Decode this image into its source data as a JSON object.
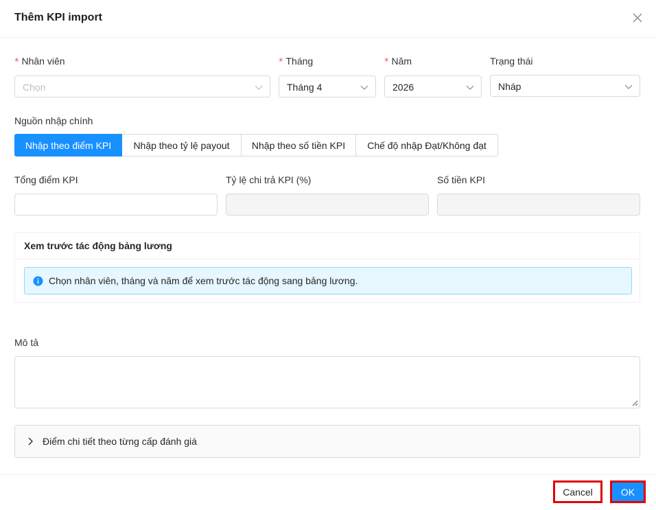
{
  "modal": {
    "title": "Thêm KPI import"
  },
  "fields": {
    "employee": {
      "label": "Nhân viên",
      "placeholder": "Chọn",
      "required": true
    },
    "month": {
      "label": "Tháng",
      "value": "Tháng 4",
      "required": true
    },
    "year": {
      "label": "Năm",
      "value": "2026",
      "required": true
    },
    "status": {
      "label": "Trạng thái",
      "value": "Nháp"
    }
  },
  "source": {
    "label": "Nguồn nhập chính",
    "options": [
      {
        "label": "Nhập theo điểm KPI",
        "active": true
      },
      {
        "label": "Nhập theo tỷ lệ payout",
        "active": false
      },
      {
        "label": "Nhập theo số tiền KPI",
        "active": false
      },
      {
        "label": "Chế độ nhập Đạt/Không đạt",
        "active": false
      }
    ]
  },
  "kpi": {
    "total_score_label": "Tổng điểm KPI",
    "payout_rate_label": "Tỷ lệ chi trả KPI (%)",
    "amount_label": "Số tiền KPI"
  },
  "preview": {
    "title": "Xem trước tác động bảng lương",
    "info": "Chọn nhân viên, tháng và năm để xem trước tác động sang bảng lương."
  },
  "description": {
    "label": "Mô tả"
  },
  "details": {
    "label": "Điểm chi tiết theo từng cấp đánh giá"
  },
  "footer": {
    "cancel_label": "Cancel",
    "ok_label": "OK"
  },
  "colors": {
    "primary": "#1890ff",
    "required": "#ff4d4f",
    "highlight": "#e00000",
    "info_bg": "#e6f7ff",
    "info_border": "#91d5ff"
  },
  "icons": {
    "close": "close-icon",
    "chevron": "chevron-down-icon",
    "info": "info-circle-icon",
    "expand": "chevron-right-icon"
  }
}
